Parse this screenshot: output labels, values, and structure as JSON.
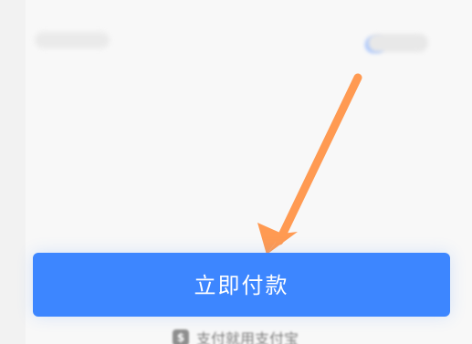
{
  "footer": {
    "security_icon": "shield-icon",
    "security_icon_glyph": "$",
    "security_text": "支付就用支付宝"
  },
  "actions": {
    "pay_button_label": "立即付款"
  },
  "visual": {
    "accent": "#3d86ff",
    "annotation_arrow_color": "#ff9a52",
    "arrow_icon": "down-left-arrow-icon"
  }
}
